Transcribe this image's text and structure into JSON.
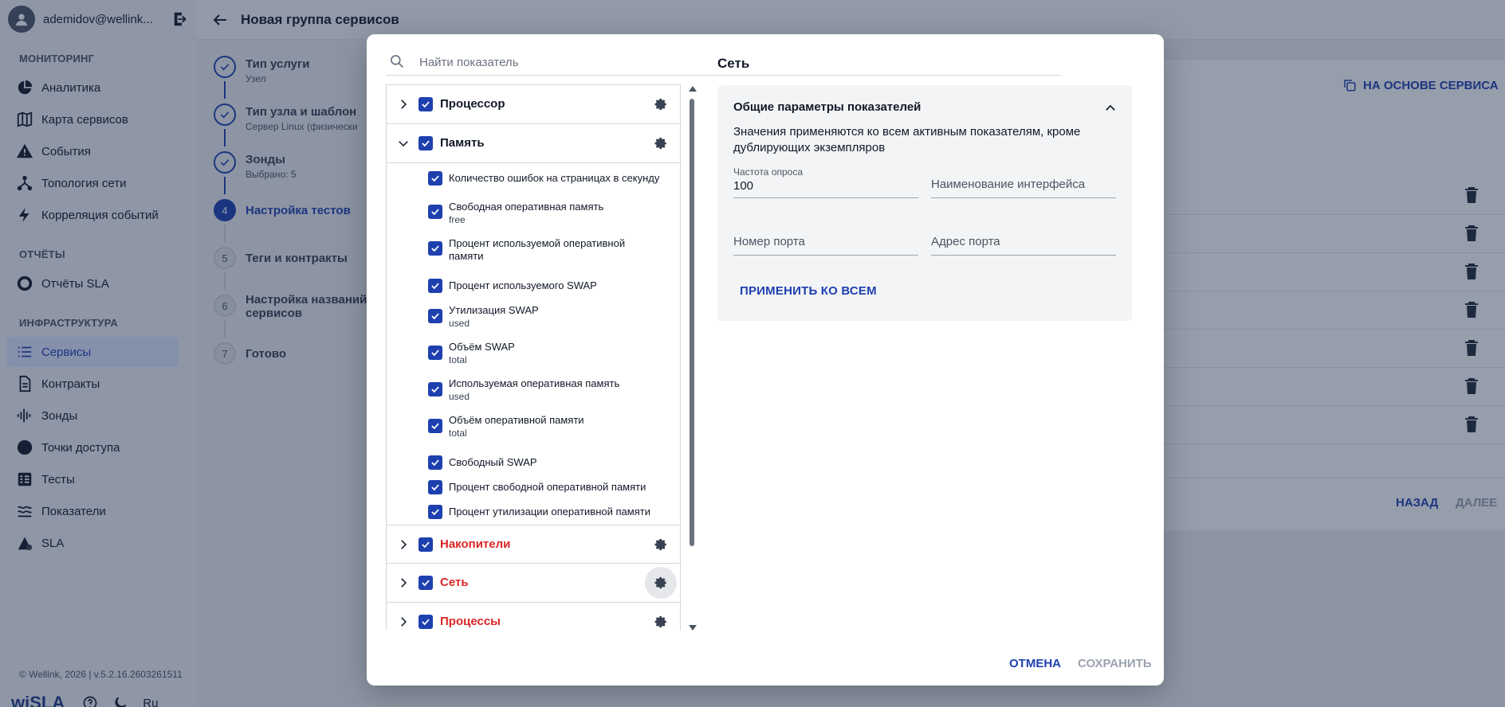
{
  "user": {
    "name": "ademidov@wellink..."
  },
  "nav": {
    "monitoring_title": "МОНИТОРИНГ",
    "monitoring": [
      {
        "label": "Аналитика",
        "icon": "pie-chart-icon"
      },
      {
        "label": "Карта сервисов",
        "icon": "map-icon"
      },
      {
        "label": "События",
        "icon": "warning-icon"
      },
      {
        "label": "Топология сети",
        "icon": "topology-icon"
      },
      {
        "label": "Корреляция событий",
        "icon": "bolt-icon"
      }
    ],
    "reports_title": "ОТЧЁТЫ",
    "reports": [
      {
        "label": "Отчёты SLA",
        "icon": "donut-icon"
      }
    ],
    "infra_title": "ИНФРАСТРУКТУРА",
    "infra": [
      {
        "label": "Сервисы",
        "icon": "list-icon",
        "active": true
      },
      {
        "label": "Контракты",
        "icon": "document-icon"
      },
      {
        "label": "Зонды",
        "icon": "signal-icon"
      },
      {
        "label": "Точки доступа",
        "icon": "circle-icon"
      },
      {
        "label": "Тесты",
        "icon": "tests-icon"
      },
      {
        "label": "Показатели",
        "icon": "metrics-icon"
      },
      {
        "label": "SLA",
        "icon": "sla-icon"
      }
    ]
  },
  "footer": {
    "copyright": "© Wellink, 2026 | v.5.2.16.2603261511",
    "brand": "wiSLA",
    "lang": "Ru"
  },
  "page": {
    "title": "Новая группа сервисов",
    "based_on": "НА ОСНОВЕ СЕРВИСА",
    "back": "НАЗАД",
    "next": "ДАЛЕЕ"
  },
  "steps": [
    {
      "num": "1",
      "title": "Тип услуги",
      "sub": "Узел",
      "state": "done"
    },
    {
      "num": "2",
      "title": "Тип узла и шаблон",
      "sub": "Сервер Linux (физически",
      "state": "done"
    },
    {
      "num": "3",
      "title": "Зонды",
      "sub": "Выбрано: 5",
      "state": "done"
    },
    {
      "num": "4",
      "title": "Настройка тестов",
      "sub": "",
      "state": "current"
    },
    {
      "num": "5",
      "title": "Теги и контракты",
      "sub": "",
      "state": "todo"
    },
    {
      "num": "6",
      "title": "Настройка названий сервисов",
      "sub": "",
      "state": "todo"
    },
    {
      "num": "7",
      "title": "Готово",
      "sub": "",
      "state": "todo"
    }
  ],
  "modal": {
    "search_placeholder": "Найти показатель",
    "groups": [
      {
        "label": "Процессор",
        "checked": true,
        "expanded": false,
        "warn": false
      },
      {
        "label": "Память",
        "checked": true,
        "expanded": true,
        "warn": false
      },
      {
        "label": "Накопители",
        "checked": true,
        "expanded": false,
        "warn": true
      },
      {
        "label": "Сеть",
        "checked": true,
        "expanded": false,
        "warn": true,
        "selected": true
      },
      {
        "label": "Процессы",
        "checked": true,
        "expanded": false,
        "warn": true
      }
    ],
    "memory_metrics": [
      {
        "label": "Количество ошибок на страницах в секунду",
        "sub": ""
      },
      {
        "label": "Свободная оперативная память",
        "sub": "free"
      },
      {
        "label": "Процент используемой оперативной памяти",
        "sub": ""
      },
      {
        "label": "Процент используемого SWAP",
        "sub": ""
      },
      {
        "label": "Утилизация SWAP",
        "sub": "used"
      },
      {
        "label": "Объём SWAP",
        "sub": "total"
      },
      {
        "label": "Используемая оперативная память",
        "sub": "used"
      },
      {
        "label": "Объём оперативной памяти",
        "sub": "total"
      },
      {
        "label": "Свободный SWAP",
        "sub": ""
      },
      {
        "label": "Процент свободной оперативной памяти",
        "sub": ""
      },
      {
        "label": "Процент утилизации оперативной памяти",
        "sub": ""
      }
    ],
    "right_title": "Сеть",
    "params": {
      "title": "Общие параметры показателей",
      "description": "Значения применяются ко всем активным показателям, кроме дублирующих экземпляров",
      "poll_label": "Частота опроса",
      "poll_value": "100",
      "iface_placeholder": "Наименование интерфейса",
      "port_num_placeholder": "Номер порта",
      "port_addr_placeholder": "Адрес порта",
      "apply_all": "ПРИМЕНИТЬ КО ВСЕМ"
    },
    "cancel": "ОТМЕНА",
    "save": "СОХРАНИТЬ"
  }
}
